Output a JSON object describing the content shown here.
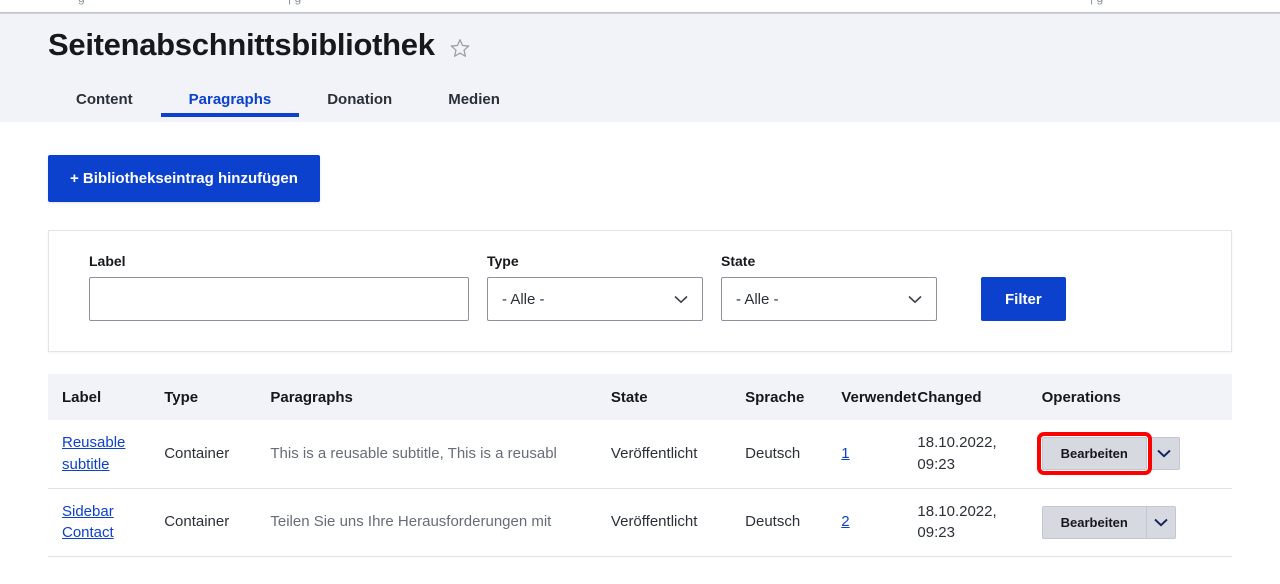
{
  "header": {
    "title": "Seitenabschnittsbibliothek",
    "favorite_icon": "star-outline-icon"
  },
  "tabs": [
    {
      "label": "Content",
      "active": false
    },
    {
      "label": "Paragraphs",
      "active": true
    },
    {
      "label": "Donation",
      "active": false
    },
    {
      "label": "Medien",
      "active": false
    }
  ],
  "actions": {
    "add_label": "+ Bibliothekseintrag hinzufügen"
  },
  "filters": {
    "label_field": {
      "label": "Label",
      "value": "",
      "placeholder": ""
    },
    "type_select": {
      "label": "Type",
      "value": "- Alle -"
    },
    "state_select": {
      "label": "State",
      "value": "- Alle -"
    },
    "submit_label": "Filter"
  },
  "table": {
    "columns": [
      "Label",
      "Type",
      "Paragraphs",
      "State",
      "Sprache",
      "Verwendet",
      "Changed",
      "Operations"
    ],
    "rows": [
      {
        "label": "Reusable subtitle",
        "type": "Container",
        "paragraphs": "This is a reusable subtitle, This is a reusabl",
        "state": "Veröffentlicht",
        "sprache": "Deutsch",
        "verwendet": "1",
        "changed": "18.10.2022, 09:23",
        "operation_label": "Bearbeiten",
        "highlighted": true
      },
      {
        "label": "Sidebar Contact",
        "type": "Container",
        "paragraphs": "Teilen Sie uns Ihre Herausforderungen mit",
        "state": "Veröffentlicht",
        "sprache": "Deutsch",
        "verwendet": "2",
        "changed": "18.10.2022, 09:23",
        "operation_label": "Bearbeiten",
        "highlighted": false
      }
    ]
  },
  "colors": {
    "accent": "#0b41cd",
    "header_band": "#f1f3f8",
    "highlight": "#ff0000",
    "muted_text": "#676c77"
  }
}
